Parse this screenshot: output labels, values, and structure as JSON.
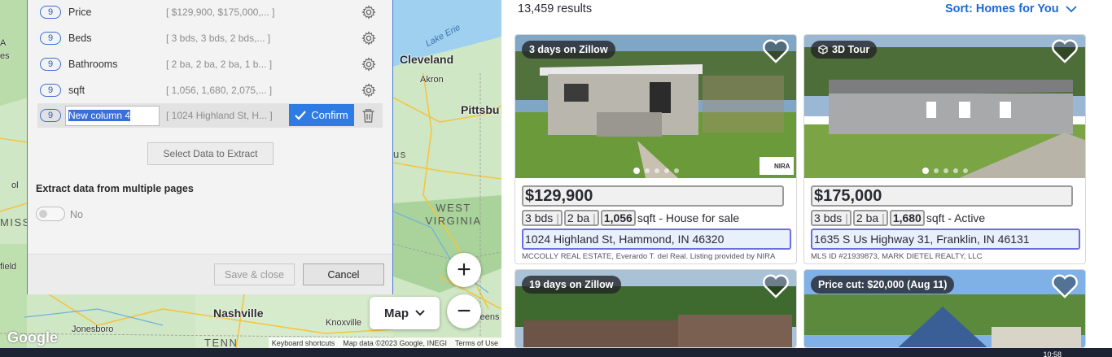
{
  "map": {
    "cities": [
      "Cleveland",
      "Akron",
      "Pittsbu",
      "Nashville",
      "Knoxville",
      "Jonesboro"
    ],
    "states": [
      "WEST VIRGINIA",
      "TENN",
      "MISS",
      "us"
    ],
    "lake": "Lake Erie",
    "partials": [
      "A",
      "es",
      "field",
      "reens",
      "ol"
    ],
    "zoom_in": "+",
    "zoom_out": "−",
    "map_type_label": "Map",
    "google_logo": "Google",
    "attribution": [
      "Keyboard shortcuts",
      "Map data ©2023 Google, INEGI",
      "Terms of Use"
    ]
  },
  "panel": {
    "rows": [
      {
        "count": "9",
        "name": "Price",
        "preview": "[ $129,900, $175,000,... ]"
      },
      {
        "count": "9",
        "name": "Beds",
        "preview": "[ 3 bds, 3 bds, 2 bds,... ]"
      },
      {
        "count": "9",
        "name": "Bathrooms",
        "preview": "[ 2 ba, 2 ba, 2 ba, 1 b... ]"
      },
      {
        "count": "9",
        "name": "sqft",
        "preview": "[ 1,056, 1,680, 2,075,... ]"
      }
    ],
    "active_row": {
      "count": "9",
      "name_value": "New column 4",
      "preview": "[ 1024 Highland St, H... ]",
      "confirm_label": "Confirm"
    },
    "select_data_label": "Select Data to Extract",
    "multi_pages_title": "Extract data from multiple pages",
    "toggle_label": "No",
    "save_label": "Save & close",
    "cancel_label": "Cancel"
  },
  "results": {
    "count": "13,459 results",
    "sort_label": "Sort: Homes for You",
    "listings": [
      {
        "tag": "3 days on Zillow",
        "price": "$129,900",
        "beds": "3",
        "beds_unit": "bds",
        "baths": "2",
        "baths_unit": "ba",
        "sqft": "1,056",
        "sqft_suffix": "sqft - House for sale",
        "address": "1024 Highland St, Hammond, IN 46320",
        "broker": "MCCOLLY REAL ESTATE, Everardo T. del Real. Listing provided by NIRA",
        "logo_text": "NIRA"
      },
      {
        "tag": "3D Tour",
        "price": "$175,000",
        "beds": "3",
        "beds_unit": "bds",
        "baths": "2",
        "baths_unit": "ba",
        "sqft": "1,680",
        "sqft_suffix": "sqft - Active",
        "address": "1635 S Us Highway 31, Franklin, IN 46131",
        "broker": "MLS ID #21939873, MARK DIETEL REALTY, LLC"
      },
      {
        "tag": "19 days on Zillow"
      },
      {
        "tag": "Price cut: $20,000 (Aug 11)"
      }
    ]
  },
  "taskbar": {
    "clock": "10:58"
  },
  "colors": {
    "accent": "#2d7be3",
    "sort_link": "#1a6ad6",
    "panel_border": "#4b7bd4"
  }
}
